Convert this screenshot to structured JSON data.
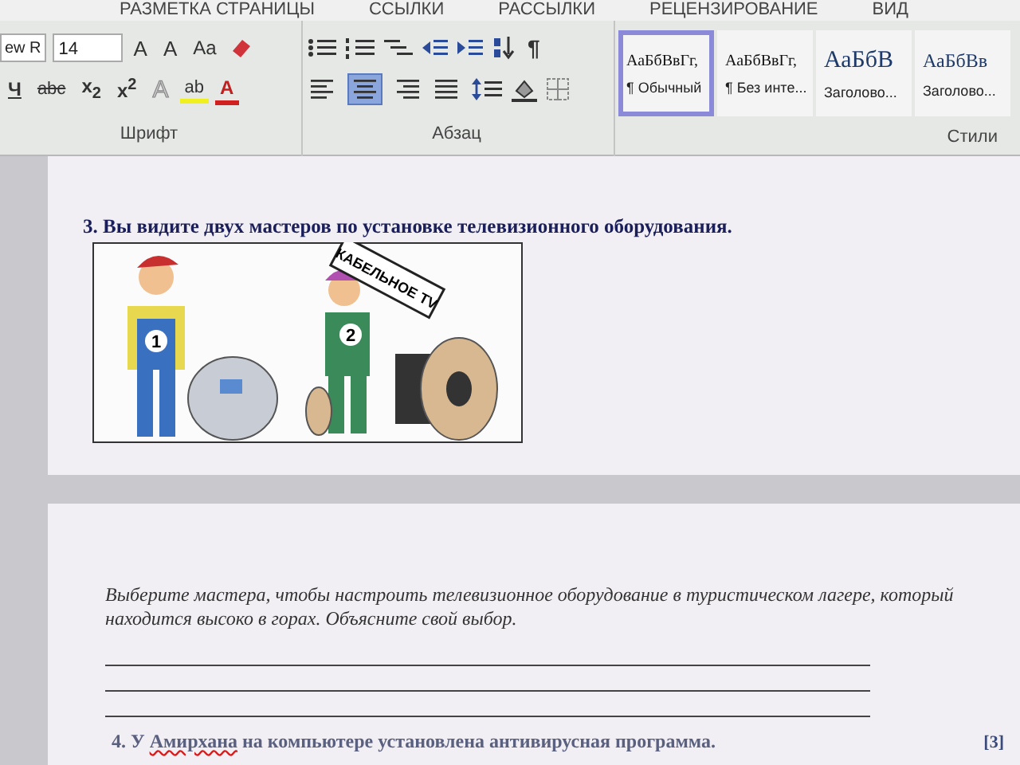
{
  "ribbon": {
    "tabs": [
      {
        "label": "РАЗМЕТКА СТРАНИЦЫ",
        "selected": false
      },
      {
        "label": "ССЫЛКИ",
        "selected": false
      },
      {
        "label": "РАССЫЛКИ",
        "selected": false
      },
      {
        "label": "РЕЦЕНЗИРОВАНИЕ",
        "selected": false
      },
      {
        "label": "ВИД",
        "selected": false
      }
    ],
    "font_group": {
      "font_name": "ew R",
      "font_size": "14",
      "label": "Шрифт",
      "row1_buttons": [
        {
          "kind": "grow",
          "text": "A"
        },
        {
          "kind": "shrink",
          "text": "A"
        },
        {
          "kind": "case",
          "text": "Aa"
        }
      ],
      "row2_buttons": [
        {
          "kind": "underline",
          "text": "Ч"
        },
        {
          "kind": "strike",
          "text": "abc"
        },
        {
          "kind": "script",
          "text": "x$_{2}$"
        },
        {
          "kind": "script",
          "text": "x$^{2}$"
        },
        {
          "kind": "effects",
          "text": "A"
        },
        {
          "kind": "highlight",
          "text": "ab"
        },
        {
          "kind": "color",
          "text": "A"
        }
      ]
    },
    "paragraph_group": {
      "label": "Абзац",
      "pilcrow": "¶",
      "align_buttons": [
        {
          "kind": "left",
          "selected": false
        },
        {
          "kind": "center",
          "selected": true
        },
        {
          "kind": "right",
          "selected": false
        },
        {
          "kind": "justify",
          "selected": false
        }
      ]
    },
    "styles_group": {
      "label": "Стили",
      "items": [
        {
          "kind": "normal",
          "sample": "АаБбВвГг,",
          "name": "¶ Обычный",
          "selected": true
        },
        {
          "kind": "normal",
          "sample": "АаБбВвГг,",
          "name": "¶ Без инте...",
          "selected": false
        },
        {
          "kind": "heading1",
          "sample": "АаБбВ",
          "name": "Заголово...",
          "selected": false
        },
        {
          "kind": "heading2",
          "sample": "АаБбВв",
          "name": "Заголово...",
          "selected": false
        }
      ]
    }
  },
  "document": {
    "question_3": "3. Вы видите двух мастеров по установке телевизионного оборудования.",
    "illustration": {
      "sign": "КАБЕЛЬНОЕ TV",
      "badges": [
        "1",
        "2"
      ]
    },
    "prompt": "Выберите мастера, чтобы настроить телевизионное оборудование в туристическом лагере, который находится высоко в горах. Объясните свой выбор.",
    "question_4": {
      "segments": [
        {
          "text": "4. У ",
          "misspelled": false
        },
        {
          "text": "Амирхана",
          "misspelled": true
        },
        {
          "text": " на компьютере установлена антивирусная программа.",
          "misspelled": false
        }
      ],
      "score": "[3]"
    }
  }
}
